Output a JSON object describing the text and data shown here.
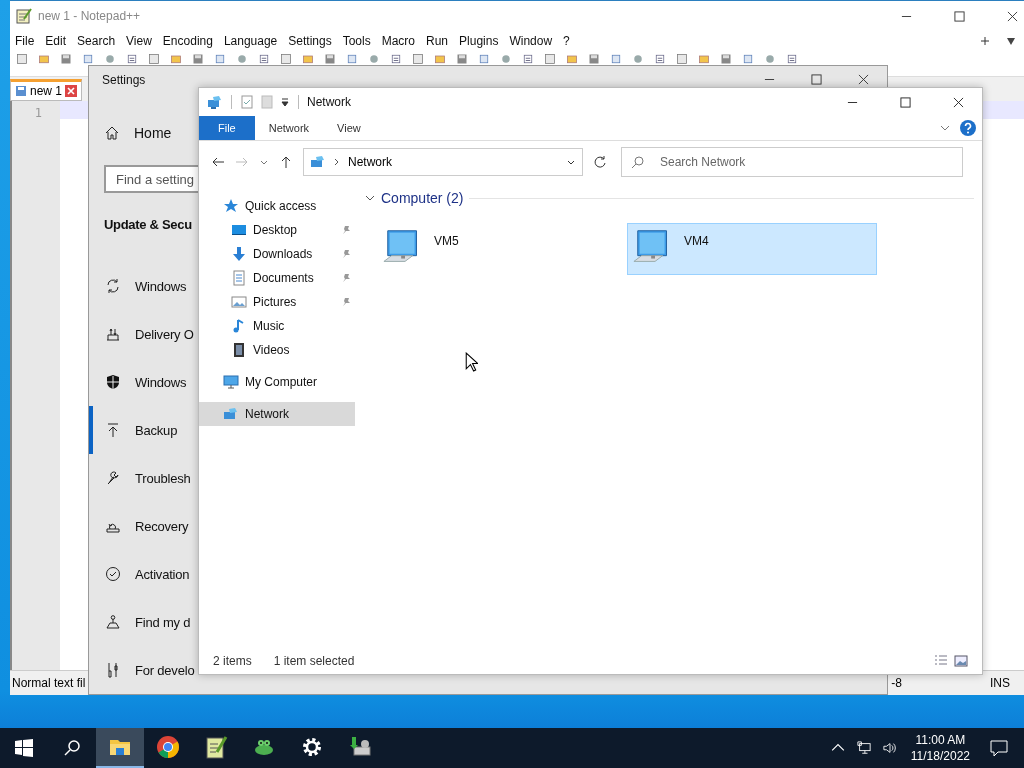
{
  "notepad": {
    "title": "new 1 - Notepad++",
    "menu": [
      "File",
      "Edit",
      "Search",
      "View",
      "Encoding",
      "Language",
      "Settings",
      "Tools",
      "Macro",
      "Run",
      "Plugins",
      "Window",
      "?"
    ],
    "tabs": [
      {
        "label": "new 1",
        "selected": true
      }
    ],
    "line_number": "1",
    "status_bar": {
      "file_type": "Normal text fil",
      "encoding": "-8",
      "mode": "INS"
    }
  },
  "settings": {
    "title": "Settings",
    "home": "Home",
    "search": {
      "placeholder": "Find a setting"
    },
    "section": "Update & Secu",
    "items": [
      {
        "label": "Windows",
        "kind": "update",
        "selected": false
      },
      {
        "label": "Delivery O",
        "kind": "delivery",
        "selected": false
      },
      {
        "label": "Windows",
        "kind": "security",
        "selected": false
      },
      {
        "label": "Backup",
        "kind": "backup",
        "selected": true
      },
      {
        "label": "Troublesh",
        "kind": "troubleshoot",
        "selected": false
      },
      {
        "label": "Recovery",
        "kind": "recovery",
        "selected": false
      },
      {
        "label": "Activation",
        "kind": "activation",
        "selected": false
      },
      {
        "label": "Find my d",
        "kind": "find",
        "selected": false
      },
      {
        "label": "For develo",
        "kind": "developer",
        "selected": false
      }
    ]
  },
  "explorer": {
    "title": "Network",
    "ribbon_tabs": [
      {
        "label": "File",
        "selected": true
      },
      {
        "label": "Network",
        "selected": false
      },
      {
        "label": "View",
        "selected": false
      }
    ],
    "address": "Network",
    "search": {
      "placeholder": "Search Network"
    },
    "nav": [
      {
        "label": "Quick access",
        "kind": "star",
        "pinned": false,
        "selected": false,
        "children": [
          {
            "label": "Desktop",
            "kind": "desktop",
            "pinned": true,
            "selected": false
          },
          {
            "label": "Downloads",
            "kind": "downloads",
            "pinned": true,
            "selected": false
          },
          {
            "label": "Documents",
            "kind": "documents",
            "pinned": true,
            "selected": false
          },
          {
            "label": "Pictures",
            "kind": "pictures",
            "pinned": true,
            "selected": false
          },
          {
            "label": "Music",
            "kind": "music",
            "pinned": false,
            "selected": false
          },
          {
            "label": "Videos",
            "kind": "videos",
            "pinned": false,
            "selected": false
          }
        ]
      },
      {
        "label": "My Computer",
        "kind": "computer",
        "pinned": false,
        "selected": false
      },
      {
        "label": "Network",
        "kind": "network",
        "pinned": false,
        "selected": true
      }
    ],
    "group": {
      "label": "Computer (2)",
      "expanded": true
    },
    "items": [
      {
        "label": "VM5",
        "selected": false
      },
      {
        "label": "VM4",
        "selected": true
      }
    ],
    "status_bar": {
      "count": "2 items",
      "selection": "1 item selected"
    }
  },
  "taskbar": {
    "apps": [
      {
        "kind": "explorer",
        "selected": true
      },
      {
        "kind": "chrome",
        "selected": false
      },
      {
        "kind": "notepad",
        "selected": false
      },
      {
        "kind": "frog",
        "selected": false
      },
      {
        "kind": "settings",
        "selected": false
      },
      {
        "kind": "installer",
        "selected": false
      }
    ],
    "time": "11:00 AM",
    "date": "11/18/2022"
  }
}
